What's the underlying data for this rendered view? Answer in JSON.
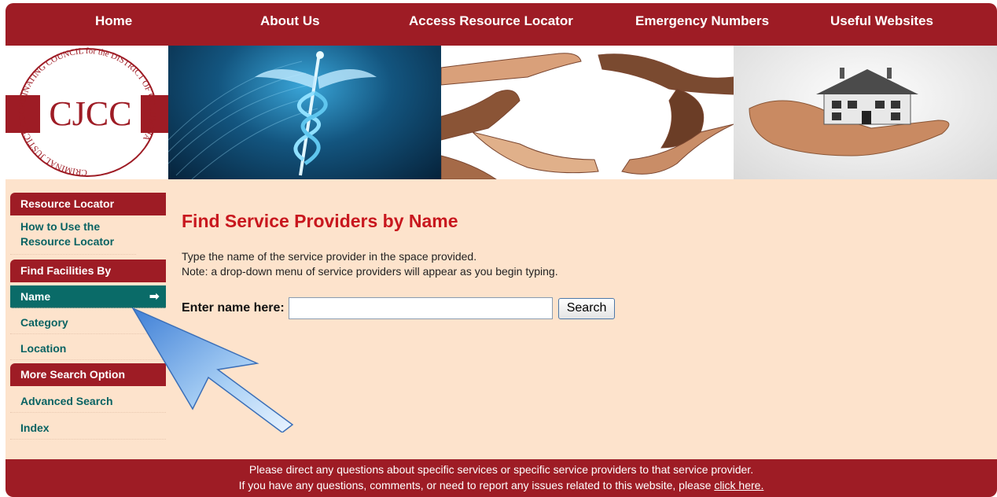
{
  "nav": {
    "home": "Home",
    "about": "About Us",
    "resource_locator": "Access Resource Locator",
    "emergency": "Emergency Numbers",
    "websites": "Useful Websites"
  },
  "logo": {
    "text": "CJCC",
    "ring_text": "CRIMINAL JUSTICE COORDINATING COUNCIL for the DISTRICT OF COLUMBIA"
  },
  "sidebar": {
    "section_resource": "Resource Locator",
    "how_to": "How to Use the Resource Locator",
    "section_find": "Find Facilities By",
    "name": "Name",
    "category": "Category",
    "location": "Location",
    "section_more": "More Search Option",
    "advanced": "Advanced Search",
    "index": "Index"
  },
  "main": {
    "title": "Find Service Providers by Name",
    "desc1": "Type the name of the service provider in the space provided.",
    "desc2": "Note: a drop-down menu of service providers will appear as you begin typing.",
    "search_label": "Enter name here:",
    "search_value": "",
    "search_button": "Search"
  },
  "footer": {
    "line1": "Please direct any questions about specific services or specific service providers to that service provider.",
    "line2": "If you have any questions, comments, or need to report any issues related to this website, please",
    "link": "click here."
  },
  "colors": {
    "brand_red": "#9e1c25",
    "teal": "#0a6b68",
    "background": "#fde3cc",
    "title_red": "#c8171e"
  },
  "icons": {
    "active_arrow": "right-arrow-icon",
    "pointer": "pointer-arrow-icon"
  }
}
